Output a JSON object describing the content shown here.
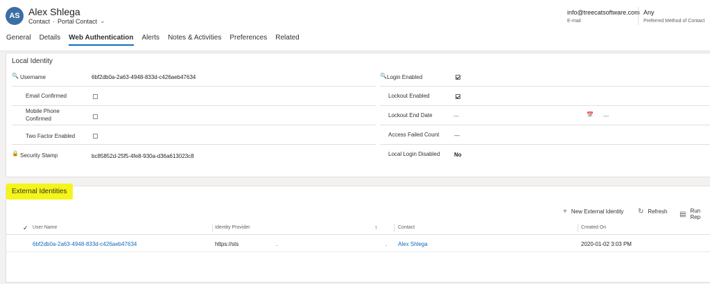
{
  "record": {
    "initials": "AS",
    "name": "Alex Shlega",
    "entity": "Contact",
    "form": "Portal Contact",
    "email_value": "info@treecatsoftware.com",
    "email_label": "E-mail",
    "pref_value": "Any",
    "pref_label": "Preferred Method of Contact"
  },
  "tabs": [
    "General",
    "Details",
    "Web Authentication",
    "Alerts",
    "Notes & Activities",
    "Preferences",
    "Related"
  ],
  "local_identity": {
    "title": "Local Identity",
    "username_label": "Username",
    "username_value": "6bf2db0a-2a63-4948-833d-c426aeb47634",
    "email_confirmed_label": "Email Confirmed",
    "mobile_confirmed_label": "Mobile Phone Confirmed",
    "two_factor_label": "Two Factor Enabled",
    "security_stamp_label": "Security Stamp",
    "security_stamp_value": "bc85852d-25f5-4fe8-930a-d36a613023c8",
    "login_enabled_label": "Login Enabled",
    "lockout_enabled_label": "Lockout Enabled",
    "lockout_end_label": "Lockout End Date",
    "lockout_end_date": "---",
    "lockout_end_time": "---",
    "access_failed_label": "Access Failed Count",
    "access_failed_value": "---",
    "local_login_disabled_label": "Local Login Disabled",
    "local_login_disabled_value": "No"
  },
  "external": {
    "title": "External Identities",
    "new_label": "New External Identity",
    "refresh_label": "Refresh",
    "run_label": "Run Rep",
    "columns": [
      "User Name",
      "Identity Provider",
      "Contact",
      "Created On"
    ],
    "row": {
      "user_name": "6bf2db0a-2a63-4948-833d-c426aeb47634",
      "provider_a": "https://sts",
      "provider_b": ".",
      "provider_c": ".",
      "contact": "Alex Shlega",
      "created_on": "2020-01-02 3:03 PM"
    }
  },
  "icons": {
    "key": "🔍",
    "lock": "🔒",
    "calendar": "📅",
    "plus": "+",
    "refresh": "↻",
    "report": "▤",
    "sort": "↑",
    "check": "✓"
  }
}
